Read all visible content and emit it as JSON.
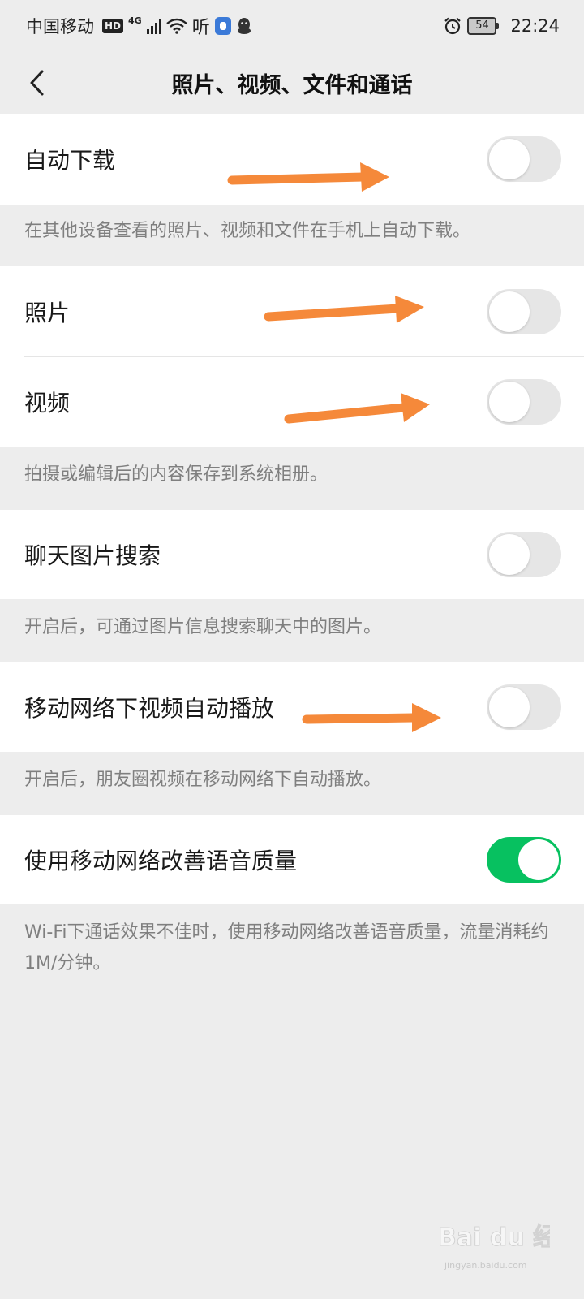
{
  "status_bar": {
    "carrier": "中国移动",
    "hd": "HD",
    "network": "4G",
    "listen_label": "听",
    "battery": "54",
    "time": "22:24"
  },
  "nav": {
    "title": "照片、视频、文件和通话",
    "back_icon": "chevron-left-icon"
  },
  "settings": {
    "auto_download": {
      "label": "自动下载",
      "enabled": false
    },
    "auto_download_desc": "在其他设备查看的照片、视频和文件在手机上自动下载。",
    "photos": {
      "label": "照片",
      "enabled": false
    },
    "videos": {
      "label": "视频",
      "enabled": false
    },
    "save_desc": "拍摄或编辑后的内容保存到系统相册。",
    "chat_image_search": {
      "label": "聊天图片搜索",
      "enabled": false
    },
    "chat_image_search_desc": "开启后，可通过图片信息搜索聊天中的图片。",
    "mobile_video_autoplay": {
      "label": "移动网络下视频自动播放",
      "enabled": false
    },
    "mobile_video_autoplay_desc": "开启后，朋友圈视频在移动网络下自动播放。",
    "voice_quality": {
      "label": "使用移动网络改善语音质量",
      "enabled": true
    },
    "voice_quality_desc": "Wi-Fi下通话效果不佳时，使用移动网络改善语音质量，流量消耗约1M/分钟。"
  },
  "colors": {
    "toggle_on": "#07c160",
    "toggle_off": "#e6e6e6",
    "annotation_arrow": "#f5893a",
    "background": "#ededed"
  },
  "watermark": {
    "text": "Bai du 经验",
    "url": "jingyan.baidu.com"
  }
}
